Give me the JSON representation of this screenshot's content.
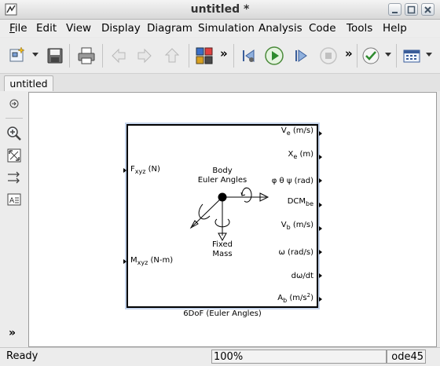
{
  "window": {
    "title": "untitled *"
  },
  "menu": [
    "File",
    "Edit",
    "View",
    "Display",
    "Diagram",
    "Simulation",
    "Analysis",
    "Code",
    "Tools",
    "Help"
  ],
  "menu_underline": [
    "F",
    "E",
    "V",
    "D",
    "D",
    "S",
    "A",
    "C",
    "T",
    "H"
  ],
  "toolbar": {
    "icons": [
      "new-model-icon",
      "save-icon",
      "print-icon",
      "back-icon",
      "forward-icon",
      "up-icon",
      "library-browser-icon",
      "step-back-icon",
      "run-icon",
      "step-forward-icon",
      "stop-icon",
      "model-advisor-icon",
      "build-icon"
    ],
    "more_label": "»"
  },
  "tab": {
    "label": "untitled"
  },
  "block": {
    "name": "6DoF (Euler Angles)",
    "center_top": [
      "Body",
      "Euler Angles"
    ],
    "center_bottom": [
      "Fixed",
      "Mass"
    ],
    "inputs": [
      {
        "main": "F",
        "sub": "xyz",
        "unit": "(N)"
      },
      {
        "main": "M",
        "sub": "xyz",
        "unit": "(N-m)"
      }
    ],
    "outputs": [
      {
        "main": "V",
        "sub": "e",
        "unit": "(m/s)"
      },
      {
        "main": "X",
        "sub": "e",
        "unit": "(m)"
      },
      {
        "main": "φ θ ψ",
        "sub": "",
        "unit": "(rad)"
      },
      {
        "main": "DCM",
        "sub": "be",
        "unit": ""
      },
      {
        "main": "V",
        "sub": "b",
        "unit": "(m/s)"
      },
      {
        "main": "ω",
        "sub": "",
        "unit": "(rad/s)"
      },
      {
        "main": "dω/dt",
        "sub": "",
        "unit": ""
      },
      {
        "main": "A",
        "sub": "b",
        "unit": "(m/s",
        "sup": "2",
        "unit_end": ")"
      }
    ]
  },
  "status": {
    "left": "Ready",
    "zoom": "100%",
    "solver": "ode45"
  }
}
